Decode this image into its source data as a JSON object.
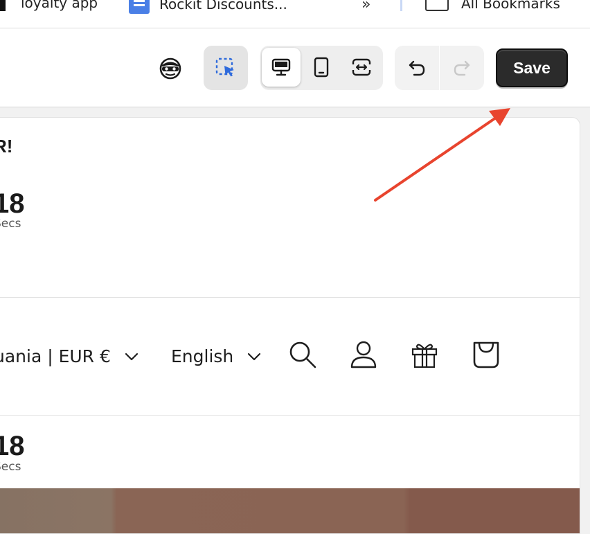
{
  "bookmarks": {
    "items": [
      {
        "label": "loyalty app"
      },
      {
        "label": "Rockit Discounts..."
      }
    ],
    "all_bookmarks": "All Bookmarks",
    "overflow_glyph": "»"
  },
  "toolbar": {
    "save_label": "Save",
    "colors": {
      "save_bg": "#2b2b2b",
      "accent": "#2f6bdc"
    }
  },
  "preview": {
    "promo_title": "R!",
    "timer_top": {
      "value": "18",
      "unit": "Secs"
    },
    "timer_bottom": {
      "value": "18",
      "unit": "Secs"
    },
    "nav": {
      "country": "uania | EUR €",
      "language": "English"
    }
  },
  "annotation": {
    "color": "#e8442e"
  }
}
